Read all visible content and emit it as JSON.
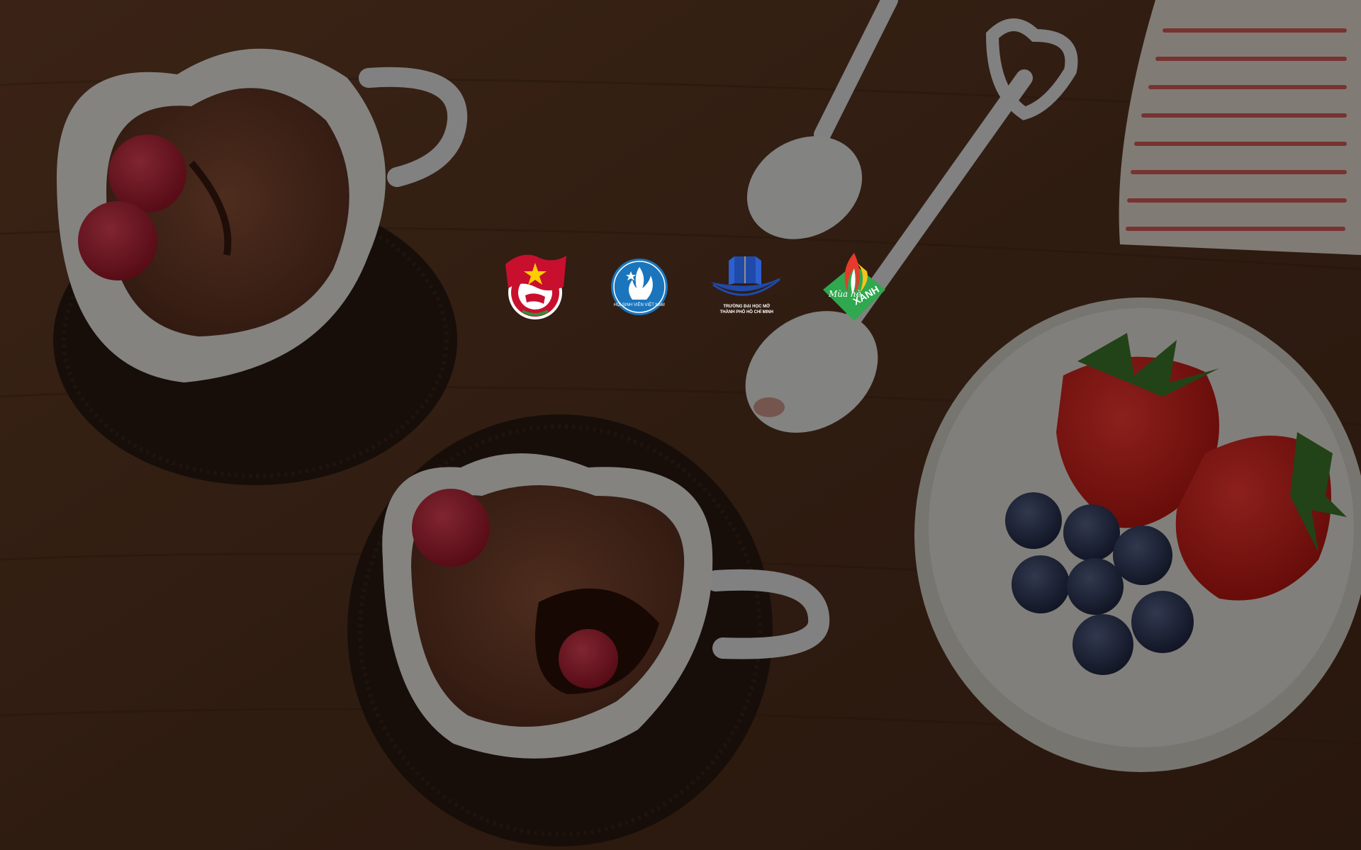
{
  "background": {
    "description_icon": "dessert-table-photo-icon",
    "overlay_color": "#000000",
    "wood_color": "#5a3621"
  },
  "logos": [
    {
      "name": "youth-union-logo",
      "caption": "",
      "colors": [
        "#c8102e",
        "#ffcd00",
        "#ffffff"
      ]
    },
    {
      "name": "student-association-logo",
      "caption": "HỘI SINH VIÊN VIỆT NAM",
      "colors": [
        "#1b75bc",
        "#ffffff"
      ]
    },
    {
      "name": "open-university-logo",
      "caption_line1": "TRƯỜNG ĐẠI HỌC MỞ",
      "caption_line2": "THÀNH PHỐ HỒ CHÍ MINH",
      "colors": [
        "#1f4aa8",
        "#ffffff"
      ]
    },
    {
      "name": "mua-he-xanh-logo",
      "text_script": "Mùa hè",
      "text_main": "XANH",
      "colors": [
        "#2fa84f",
        "#e63a2b",
        "#f7c31a",
        "#ffffff"
      ]
    }
  ]
}
